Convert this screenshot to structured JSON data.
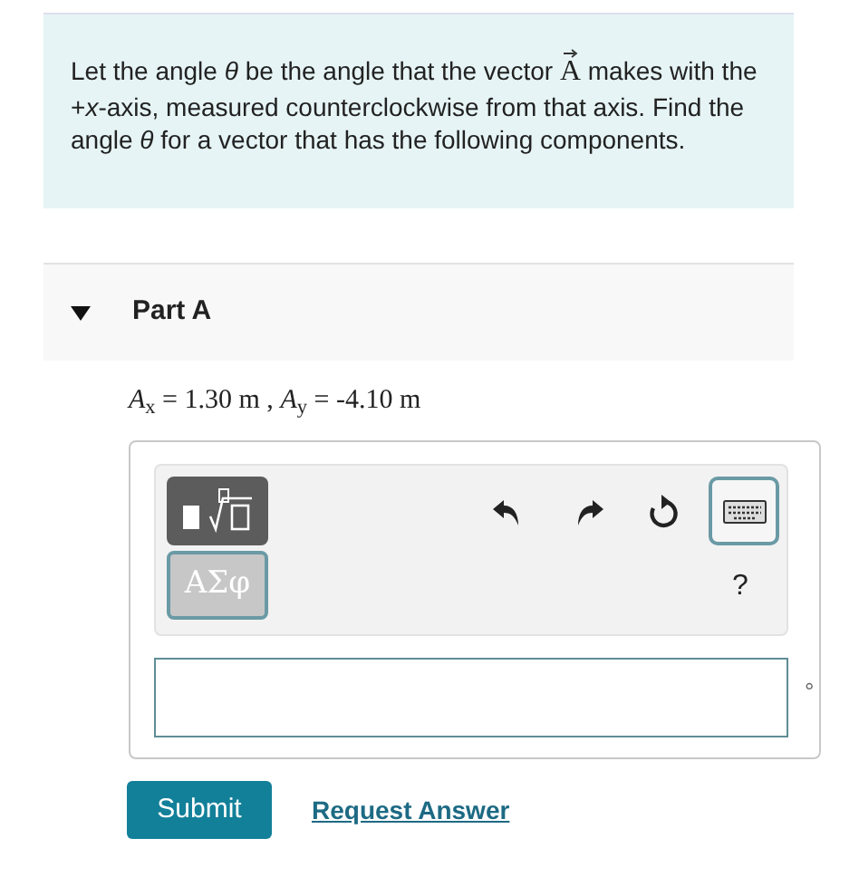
{
  "intro": {
    "before": "Let the angle *θ* be the angle that the vector",
    "vector": "A",
    "after": "makes with the +*x*-axis, measured counterclockwise from that axis. Find the angle *θ* for a vector that has the following components."
  },
  "part": {
    "title": "Part A",
    "expanded": true
  },
  "components": "*A*$_{x}$ = 1.30 m , *A*$_{y}$ = -4.10 m",
  "toolbar": {
    "symbols_button": "ΑΣφ",
    "help": "?"
  },
  "answer": {
    "unit": "°"
  },
  "buttons": {
    "submit": "Submit",
    "request": "Request Answer"
  }
}
